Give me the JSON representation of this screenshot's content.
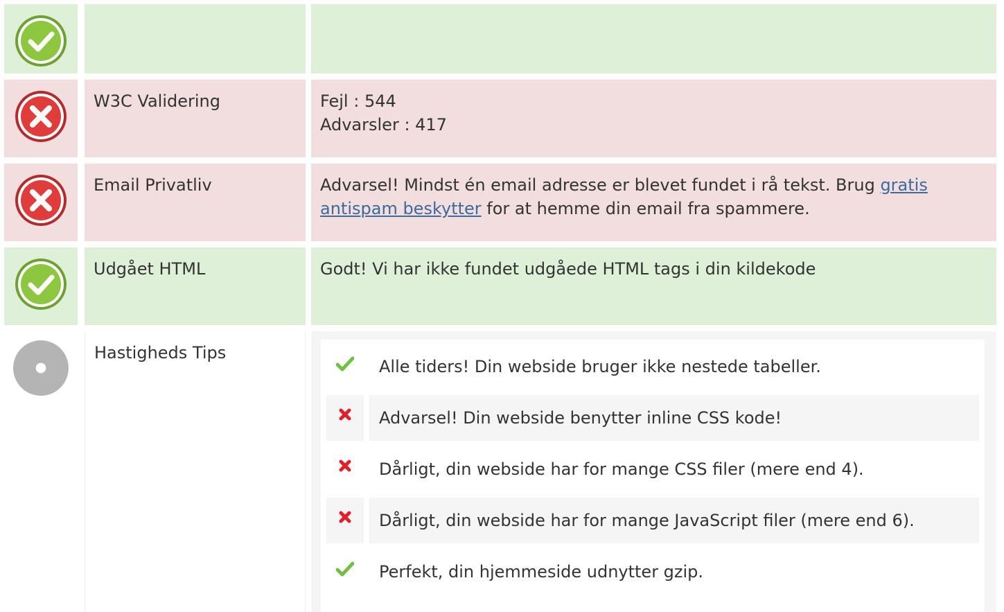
{
  "rows": [
    {
      "status": "ok",
      "icon": "check-circle-icon",
      "label": "",
      "value_lines": []
    },
    {
      "status": "error",
      "icon": "x-circle-icon",
      "label": "W3C Validering",
      "value_lines": [
        "Fejl : 544",
        "Advarsler : 417"
      ]
    },
    {
      "status": "error",
      "icon": "x-circle-icon",
      "label": "Email Privatliv",
      "value_prefix": "Advarsel! Mindst én email adresse er blevet fundet i rå tekst. Brug ",
      "value_link": "gratis antispam beskytter",
      "value_suffix": " for at hemme din email fra spammere."
    },
    {
      "status": "ok",
      "icon": "check-circle-icon",
      "label": "Udgået HTML",
      "value": "Godt! Vi har ikke fundet udgåede HTML tags i din kildekode"
    },
    {
      "status": "neutral",
      "icon": "neutral-circle-icon",
      "label": "Hastigheds Tips"
    }
  ],
  "tips": [
    {
      "status": "pass",
      "icon": "checkmark-icon",
      "text": "Alle tiders! Din webside bruger ikke nestede tabeller."
    },
    {
      "status": "fail",
      "icon": "cross-icon",
      "text": "Advarsel! Din webside benytter inline CSS kode!"
    },
    {
      "status": "fail",
      "icon": "cross-icon",
      "text": "Dårligt, din webside har for mange CSS filer (mere end 4)."
    },
    {
      "status": "fail",
      "icon": "cross-icon",
      "text": "Dårligt, din webside har for mange JavaScript filer (mere end 6)."
    },
    {
      "status": "pass",
      "icon": "checkmark-icon",
      "text": "Perfekt, din hjemmeside udnytter gzip."
    }
  ],
  "colors": {
    "ok_bg": "#dff0d8",
    "error_bg": "#f2dede",
    "ok_green": "#8dc63f",
    "error_red": "#e03c3c",
    "neutral_gray": "#b4b4b4",
    "link": "#3c6a9b",
    "pass_mark": "#72bf44",
    "fail_mark": "#e3202a"
  }
}
